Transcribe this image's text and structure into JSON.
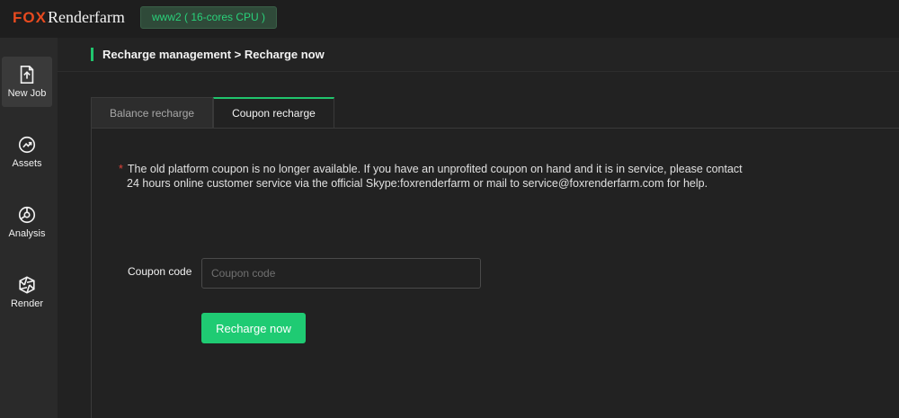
{
  "header": {
    "logo_fox": "FOX",
    "logo_rest": "Renderfarm",
    "server_badge": "www2 ( 16-cores CPU )"
  },
  "sidebar": {
    "items": [
      {
        "label": "New Job",
        "icon": "new-job-icon",
        "active": true
      },
      {
        "label": "Assets",
        "icon": "assets-icon",
        "active": false
      },
      {
        "label": "Analysis",
        "icon": "analysis-icon",
        "active": false
      },
      {
        "label": "Render",
        "icon": "render-icon",
        "active": false
      }
    ]
  },
  "breadcrumb": "Recharge management > Recharge now",
  "tabs": [
    {
      "label": "Balance recharge",
      "active": false
    },
    {
      "label": "Coupon recharge",
      "active": true
    }
  ],
  "notice": {
    "marker": "*",
    "line1": "The old platform coupon is no longer available. If you have an unprofited coupon on hand and it is in service, please contact",
    "line2": "24 hours online customer service via the official Skype:foxrenderfarm or mail to service@foxrenderfarm.com for help."
  },
  "form": {
    "coupon_label": "Coupon code",
    "coupon_placeholder": "Coupon code",
    "coupon_value": "",
    "submit_label": "Recharge now"
  },
  "colors": {
    "accent": "#1fcb73",
    "brand": "#e84a1f",
    "required_marker": "#e0433a"
  }
}
